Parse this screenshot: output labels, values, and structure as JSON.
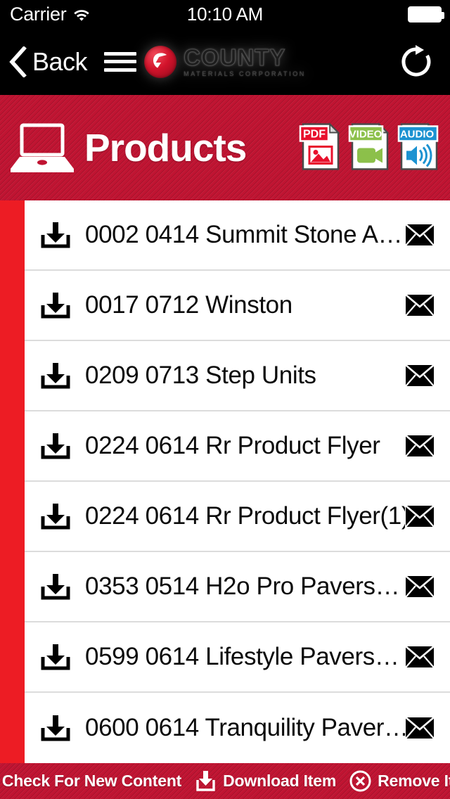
{
  "statusbar": {
    "carrier": "Carrier",
    "time": "10:10 AM",
    "wifi_icon": "wifi-icon",
    "battery_icon": "battery-full-icon"
  },
  "navbar": {
    "back_label": "Back",
    "back_icon": "chevron-left-icon",
    "menu_icon": "hamburger-menu-icon",
    "refresh_icon": "refresh-icon",
    "logo": {
      "name": "COUNTY",
      "tagline": "MATERIALS CORPORATION",
      "badge_icon": "county-badge-icon"
    }
  },
  "header": {
    "title": "Products",
    "icon": "laptop-icon",
    "accent_color": "#c01432",
    "file_types": [
      {
        "label": "PDF",
        "glyph": "image-icon",
        "color": "#e8112d"
      },
      {
        "label": "VIDEO",
        "glyph": "camcorder-icon",
        "color": "#8cc04a"
      },
      {
        "label": "AUDIO",
        "glyph": "speaker-icon",
        "color": "#1b92d1"
      }
    ]
  },
  "list": {
    "rail_color": "#ed1c24",
    "download_icon": "download-icon",
    "mail_icon": "envelope-icon",
    "rows": [
      {
        "label": "0002 0414 Summit Stone A…"
      },
      {
        "label": "0017 0712 Winston"
      },
      {
        "label": "0209 0713 Step Units"
      },
      {
        "label": "0224 0614 Rr Product Flyer"
      },
      {
        "label": "0224 0614 Rr Product Flyer(1)"
      },
      {
        "label": "0353 0514 H2o Pro Pavers…"
      },
      {
        "label": "0599 0614 Lifestyle Pavers…"
      },
      {
        "label": "0600 0614 Tranquility Paver…"
      }
    ]
  },
  "toolbar": {
    "actions": [
      {
        "label": "Check For New Content",
        "icon": "refresh-icon"
      },
      {
        "label": "Download Item",
        "icon": "download-icon"
      },
      {
        "label": "Remove Item",
        "icon": "remove-circle-icon"
      }
    ]
  }
}
